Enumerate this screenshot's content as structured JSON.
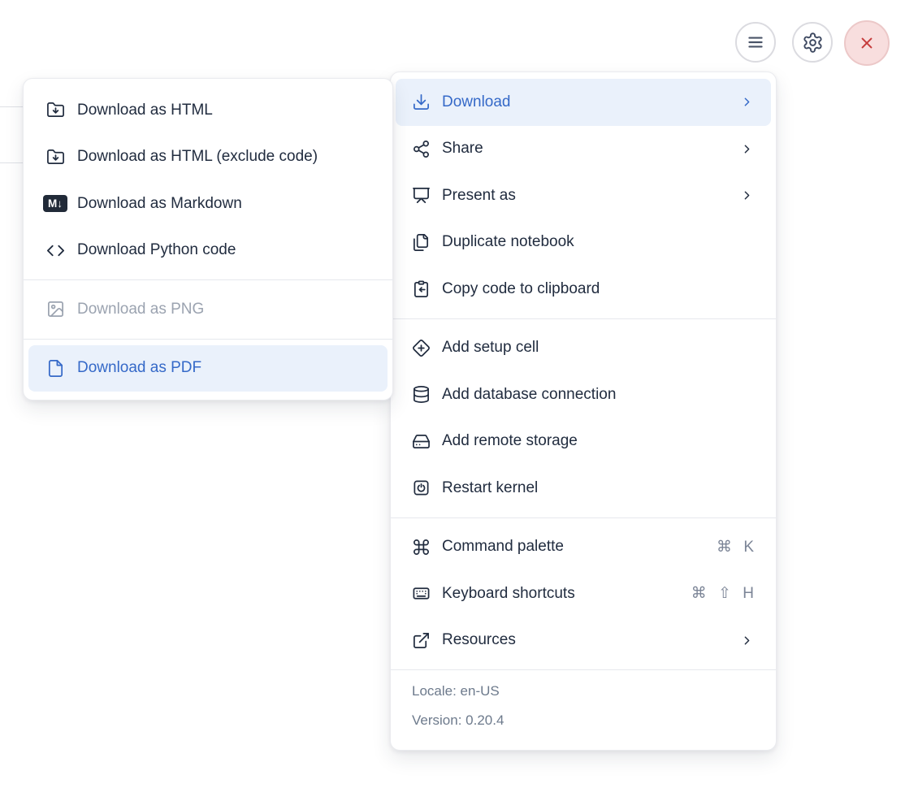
{
  "toolbar": {
    "buttons": [
      {
        "name": "menu",
        "icon": "hamburger-icon"
      },
      {
        "name": "settings",
        "icon": "gear-icon"
      },
      {
        "name": "close",
        "icon": "close-x-icon"
      }
    ]
  },
  "download_submenu": {
    "items": [
      {
        "label": "Download as HTML",
        "icon": "folder-down-icon",
        "state": "normal"
      },
      {
        "label": "Download as HTML (exclude code)",
        "icon": "folder-down-icon",
        "state": "normal"
      },
      {
        "label": "Download as Markdown",
        "icon": "markdown-badge-icon",
        "badge_text": "M↓",
        "state": "normal"
      },
      {
        "label": "Download Python code",
        "icon": "code-icon",
        "state": "normal"
      },
      {
        "label": "Download as PNG",
        "icon": "image-icon",
        "state": "disabled"
      },
      {
        "label": "Download as PDF",
        "icon": "file-icon",
        "state": "highlighted"
      }
    ]
  },
  "main_menu": {
    "items": [
      {
        "label": "Download",
        "icon": "download-icon",
        "has_submenu": true,
        "state": "highlighted"
      },
      {
        "label": "Share",
        "icon": "share-icon",
        "has_submenu": true,
        "state": "normal"
      },
      {
        "label": "Present as",
        "icon": "presentation-icon",
        "has_submenu": true,
        "state": "normal"
      },
      {
        "label": "Duplicate notebook",
        "icon": "duplicate-files-icon",
        "has_submenu": false,
        "state": "normal"
      },
      {
        "label": "Copy code to clipboard",
        "icon": "clipboard-copy-icon",
        "has_submenu": false,
        "state": "normal"
      },
      {
        "label": "Add setup cell",
        "icon": "diamond-plus-icon",
        "has_submenu": false,
        "state": "normal"
      },
      {
        "label": "Add database connection",
        "icon": "database-icon",
        "has_submenu": false,
        "state": "normal"
      },
      {
        "label": "Add remote storage",
        "icon": "hard-drive-icon",
        "has_submenu": false,
        "state": "normal"
      },
      {
        "label": "Restart kernel",
        "icon": "power-square-icon",
        "has_submenu": false,
        "state": "normal"
      },
      {
        "label": "Command palette",
        "icon": "command-icon",
        "shortcut": "⌘ K",
        "state": "normal"
      },
      {
        "label": "Keyboard shortcuts",
        "icon": "keyboard-icon",
        "shortcut": "⌘ ⇧ H",
        "state": "normal"
      },
      {
        "label": "Resources",
        "icon": "external-link-icon",
        "has_submenu": true,
        "state": "normal"
      }
    ],
    "footer": {
      "locale": "Locale: en-US",
      "version": "Version: 0.20.4"
    }
  },
  "colors": {
    "accent_blue": "#3569c8",
    "accent_blue_bg": "#eaf1fb",
    "text": "#212c3f",
    "muted_footer": "#6d7a8c",
    "shortcut_gray": "#7b8496",
    "disabled_gray": "#9ba3b0",
    "divider": "#e6e8ed",
    "danger_red": "#c63d3d",
    "danger_bg": "#f8dede",
    "danger_border": "#ecc8c8"
  }
}
